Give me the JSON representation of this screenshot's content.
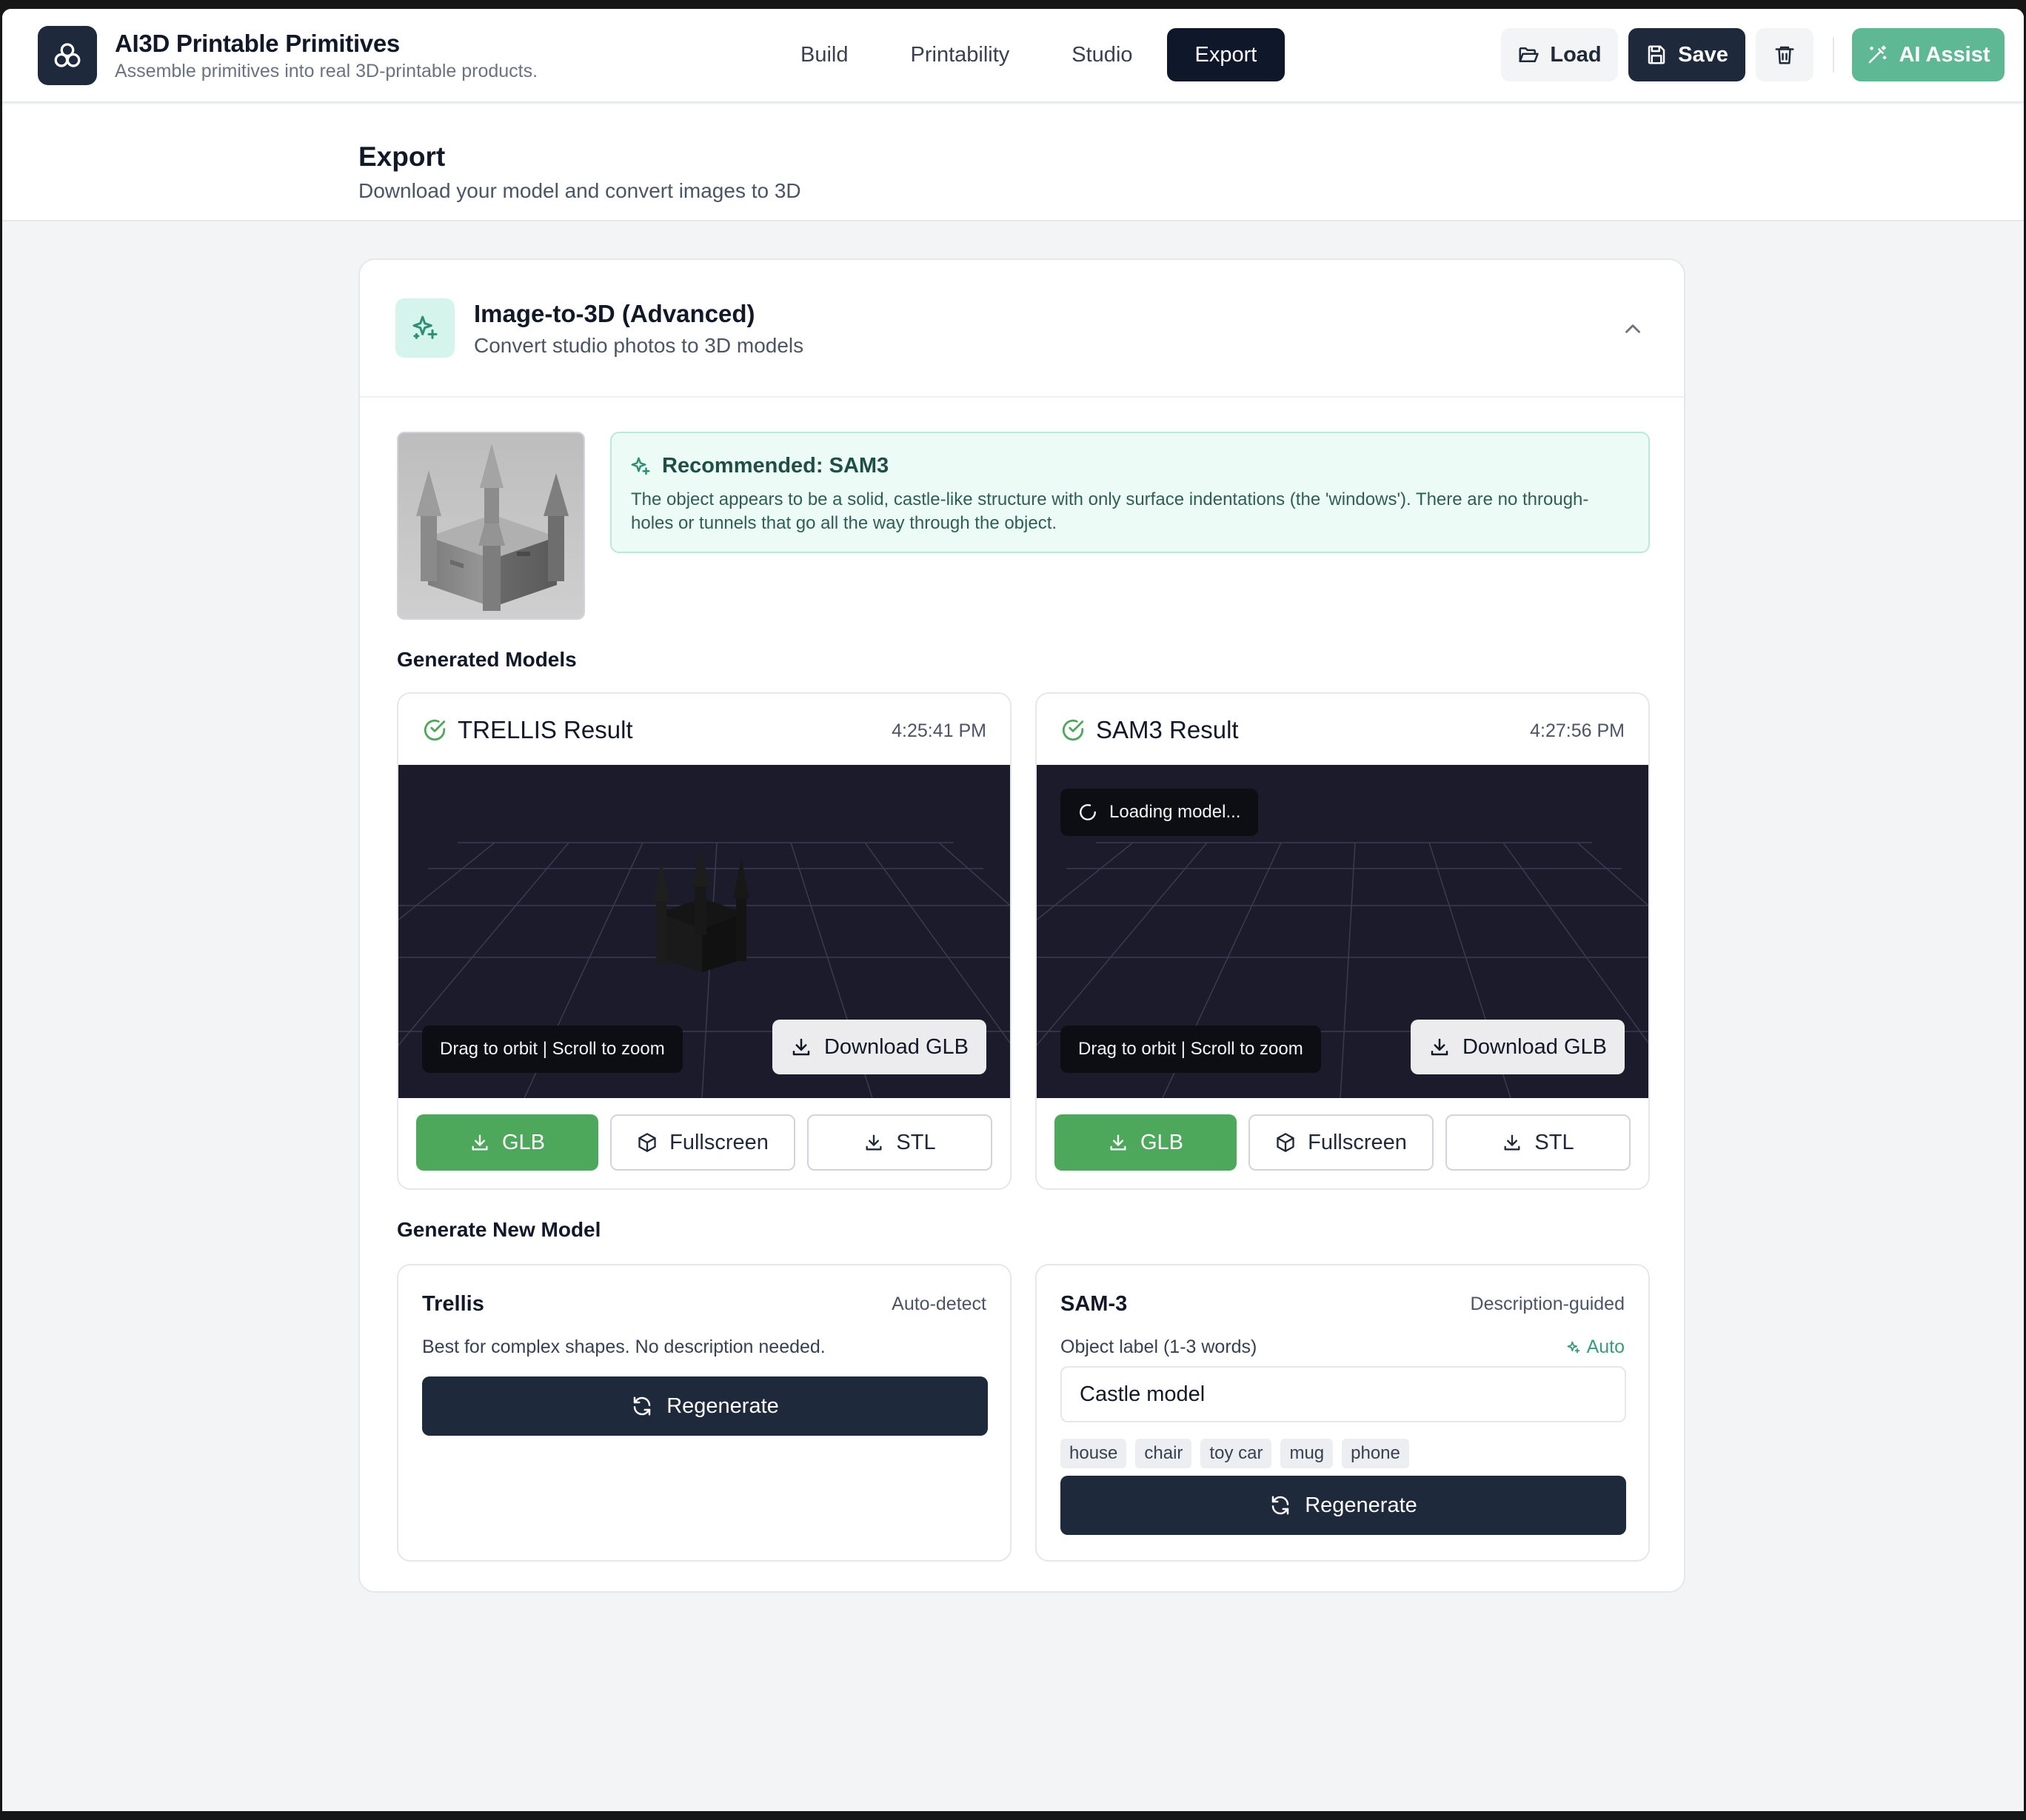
{
  "app": {
    "title": "AI3D Printable Primitives",
    "subtitle": "Assemble primitives into real 3D-printable products."
  },
  "nav": {
    "tabs": [
      {
        "label": "Build",
        "active": false
      },
      {
        "label": "Printability",
        "active": false
      },
      {
        "label": "Studio",
        "active": false
      },
      {
        "label": "Export",
        "active": true
      }
    ]
  },
  "header_actions": {
    "load_label": "Load",
    "save_label": "Save",
    "ai_label": "AI Assist"
  },
  "page": {
    "title": "Export",
    "subtitle": "Download your model and convert images to 3D"
  },
  "section": {
    "title": "Image-to-3D (Advanced)",
    "subtitle": "Convert studio photos to 3D models"
  },
  "recommendation": {
    "title": "Recommended: SAM3",
    "text": "The object appears to be a solid, castle-like structure with only surface indentations (the 'windows'). There are no through-holes or tunnels that go all the way through the object."
  },
  "generated_models": {
    "heading": "Generated Models",
    "results": [
      {
        "title": "TRELLIS Result",
        "time": "4:25:41 PM",
        "hint": "Drag to orbit | Scroll to zoom",
        "download_label": "Download GLB",
        "loading": "",
        "actions": {
          "glb": "GLB",
          "fullscreen": "Fullscreen",
          "stl": "STL"
        }
      },
      {
        "title": "SAM3 Result",
        "time": "4:27:56 PM",
        "hint": "Drag to orbit | Scroll to zoom",
        "download_label": "Download GLB",
        "loading": "Loading model...",
        "actions": {
          "glb": "GLB",
          "fullscreen": "Fullscreen",
          "stl": "STL"
        }
      }
    ]
  },
  "generate_new": {
    "heading": "Generate New Model",
    "trellis": {
      "title": "Trellis",
      "tag": "Auto-detect",
      "description": "Best for complex shapes. No description needed.",
      "button": "Regenerate"
    },
    "sam3": {
      "title": "SAM-3",
      "tag": "Description-guided",
      "field_label": "Object label (1-3 words)",
      "auto_label": "Auto",
      "input_value": "Castle model",
      "suggestions": [
        "house",
        "chair",
        "toy car",
        "mug",
        "phone"
      ],
      "button": "Regenerate"
    }
  },
  "colors": {
    "accent": "#5fb894",
    "success": "#4ea85c",
    "dark": "#1e293b",
    "viewport_bg": "#1b1b2b"
  }
}
